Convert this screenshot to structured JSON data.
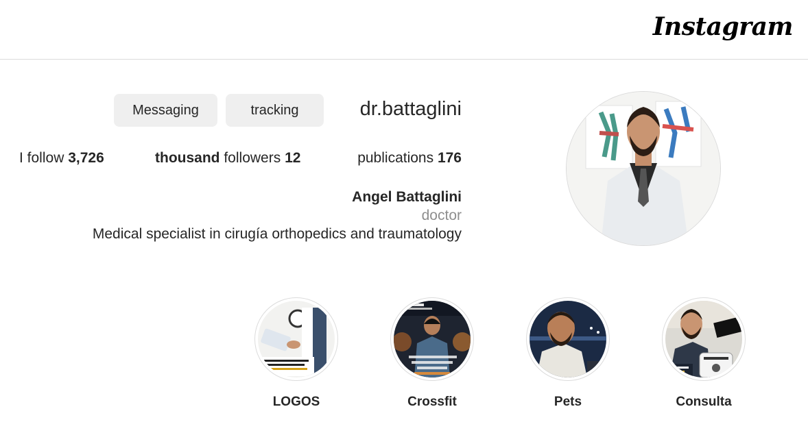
{
  "brand": {
    "logo_text": "Instagram"
  },
  "profile": {
    "username": "dr.battaglini",
    "buttons": {
      "messaging": "Messaging",
      "tracking": "tracking"
    },
    "stats": {
      "follow_label": "I follow",
      "follow_value": "3,726",
      "followers_prefix": "thousand",
      "followers_label": "followers",
      "followers_value": "12",
      "publications_label": "publications",
      "publications_value": "176"
    },
    "full_name": "Angel Battaglini",
    "category": "doctor",
    "bio": "Medical specialist in cirugía orthopedics and traumatology"
  },
  "highlights": [
    {
      "label": "LOGOS",
      "icon": "highlight-logos-thumb"
    },
    {
      "label": "Crossfit",
      "icon": "highlight-crossfit-thumb"
    },
    {
      "label": "Pets",
      "icon": "highlight-pets-thumb"
    },
    {
      "label": "Consulta",
      "icon": "highlight-consulta-thumb"
    }
  ]
}
